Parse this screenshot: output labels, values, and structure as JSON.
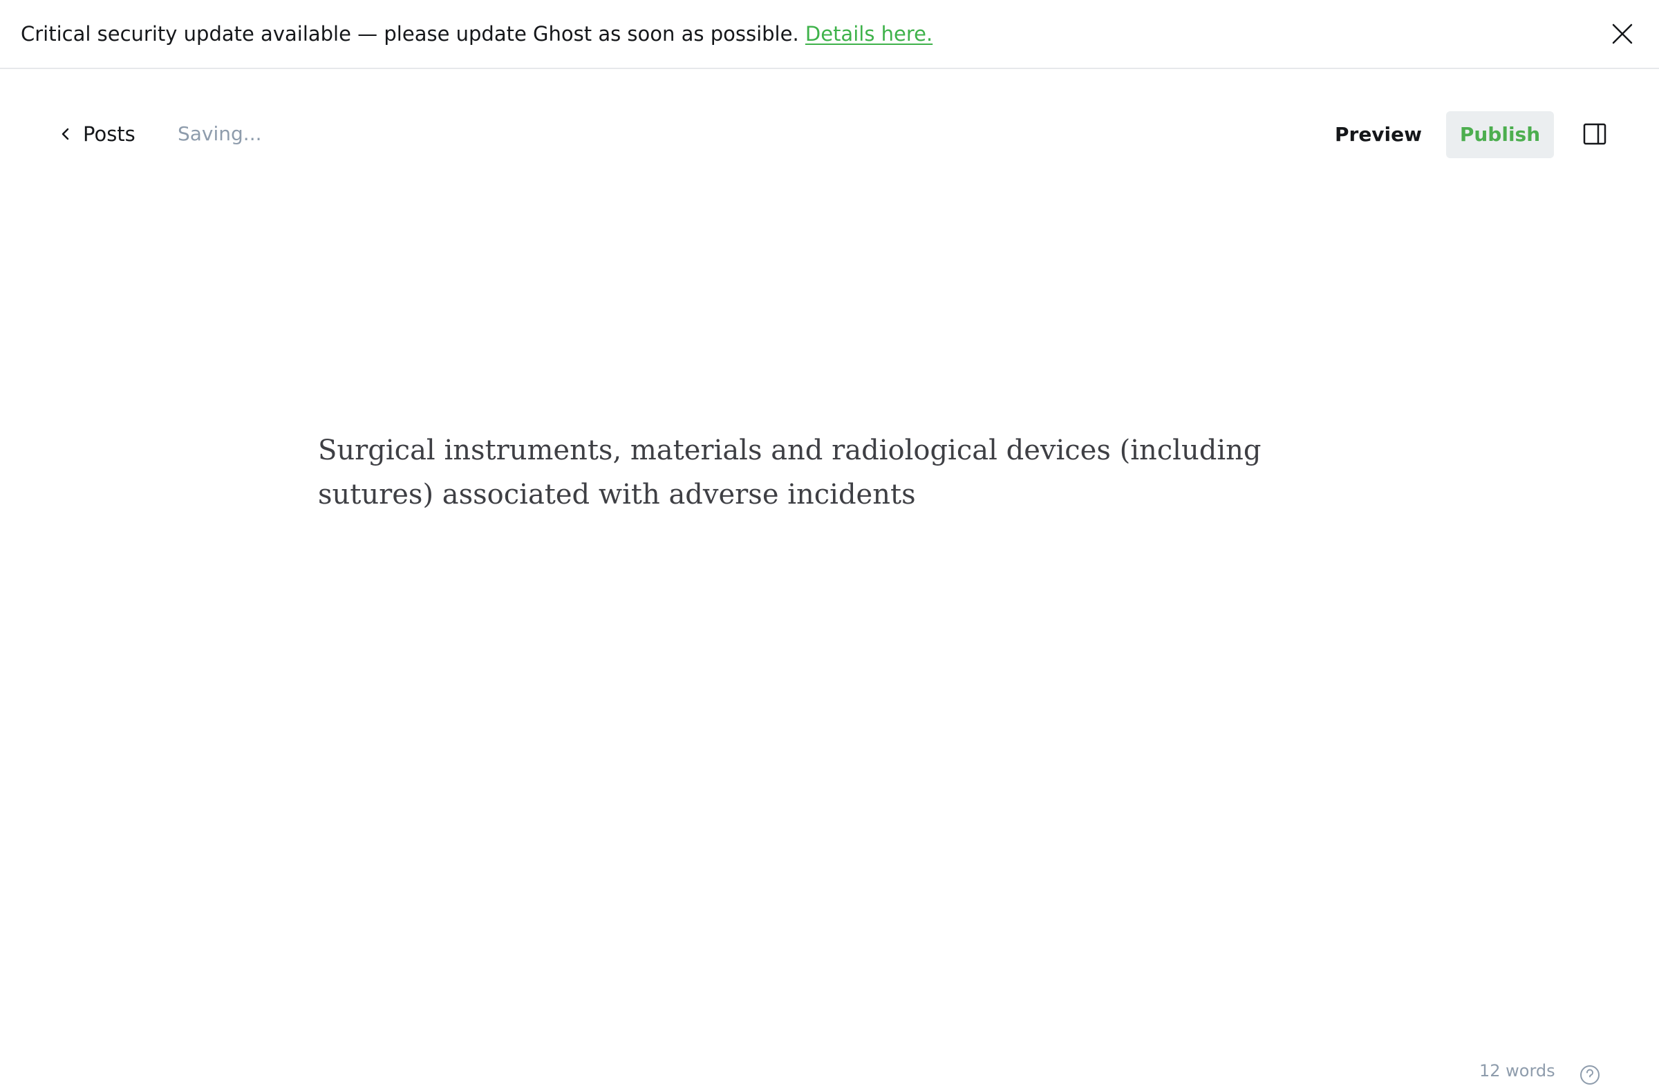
{
  "banner": {
    "message": "Critical security update available — please update Ghost as soon as possible.",
    "link_label": "Details here.",
    "close_icon": "close-icon"
  },
  "header": {
    "back_label": "Posts",
    "back_icon": "chevron-left-icon",
    "status": "Saving...",
    "preview_label": "Preview",
    "publish_label": "Publish",
    "sidebar_icon": "sidebar-toggle-icon"
  },
  "editor": {
    "title": "Surgical instruments, materials and radiological devices (including sutures) associated with adverse incidents"
  },
  "footer": {
    "word_count": "12 words",
    "help_icon": "help-icon"
  },
  "colors": {
    "accent": "#4cae4f",
    "text": "#15171a",
    "muted": "#8e9cac",
    "button_bg": "#ebeef0",
    "divider": "#e6e8eb"
  }
}
